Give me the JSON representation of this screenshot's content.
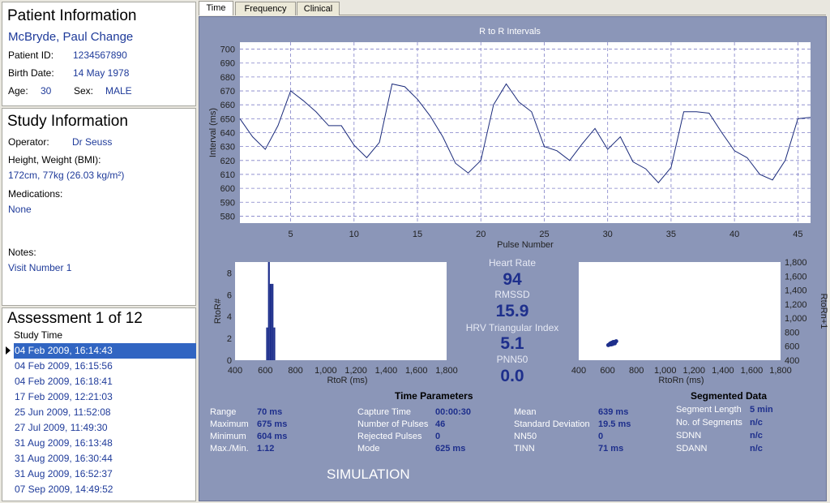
{
  "patient": {
    "title": "Patient Information",
    "name": "McBryde, Paul Change",
    "id_label": "Patient ID:",
    "id_value": "1234567890",
    "dob_label": "Birth Date:",
    "dob_value": "14 May 1978",
    "age_label": "Age:",
    "age_value": "30",
    "sex_label": "Sex:",
    "sex_value": "MALE"
  },
  "study": {
    "title": "Study Information",
    "operator_label": "Operator:",
    "operator_value": "Dr Seuss",
    "hw_label": "Height, Weight (BMI):",
    "hw_value": "172cm, 77kg (26.03 kg/m²)",
    "med_label": "Medications:",
    "med_value": "None",
    "notes_label": "Notes:",
    "notes_value": "Visit Number 1"
  },
  "assessment": {
    "title": "Assessment 1 of 12",
    "column": "Study Time",
    "selected_index": 0,
    "items": [
      "04 Feb 2009, 16:14:43",
      "04 Feb 2009, 16:15:56",
      "04 Feb 2009, 16:18:41",
      "17 Feb 2009, 12:21:03",
      "25 Jun 2009, 11:52:08",
      "27 Jul 2009, 11:49:30",
      "31 Aug 2009, 16:13:48",
      "31 Aug 2009, 16:30:44",
      "31 Aug 2009, 16:52:37",
      "07 Sep 2009, 14:49:52"
    ]
  },
  "tabs": [
    "Time",
    "Frequency",
    "Clinical"
  ],
  "active_tab": "Time",
  "chart_data": [
    {
      "type": "line",
      "title": "R to R Intervals",
      "xlabel": "Pulse Number",
      "ylabel": "Interval (ms)",
      "xlim": [
        1,
        46
      ],
      "ylim": [
        575,
        705
      ],
      "xticks": [
        5,
        10,
        15,
        20,
        25,
        30,
        35,
        40,
        45
      ],
      "yticks": [
        580,
        590,
        600,
        610,
        620,
        630,
        640,
        650,
        660,
        670,
        680,
        690,
        700
      ],
      "grid": true,
      "x": [
        1,
        2,
        3,
        4,
        5,
        6,
        7,
        8,
        9,
        10,
        11,
        12,
        13,
        14,
        15,
        16,
        17,
        18,
        19,
        20,
        21,
        22,
        23,
        24,
        25,
        26,
        27,
        28,
        29,
        30,
        31,
        32,
        33,
        34,
        35,
        36,
        37,
        38,
        39,
        40,
        41,
        42,
        43,
        44,
        45,
        46
      ],
      "values": [
        650,
        637,
        628,
        645,
        670,
        663,
        655,
        645,
        645,
        631,
        622,
        633,
        675,
        673,
        664,
        652,
        637,
        618,
        611,
        620,
        660,
        675,
        662,
        655,
        630,
        627,
        620,
        632,
        643,
        628,
        637,
        619,
        614,
        604,
        615,
        655,
        655,
        654,
        640,
        627,
        622,
        610,
        606,
        620,
        650,
        651
      ]
    },
    {
      "type": "bar",
      "title": "",
      "xlabel": "RtoR (ms)",
      "ylabel": "RtoR#",
      "xlim": [
        400,
        1800
      ],
      "ylim": [
        0,
        9
      ],
      "xticks": [
        400,
        600,
        800,
        1000,
        1200,
        1400,
        1600,
        1800
      ],
      "yticks": [
        0,
        2,
        4,
        6,
        8
      ],
      "bin_width": 12,
      "x": [
        612,
        624,
        636,
        648,
        660
      ],
      "values": [
        3,
        9,
        7,
        7,
        3
      ]
    },
    {
      "type": "scatter",
      "title": "",
      "xlabel": "RtoRn (ms)",
      "ylabel": "RtoRn+1",
      "xlim": [
        400,
        1800
      ],
      "ylim": [
        400,
        1800
      ],
      "xticks": [
        400,
        600,
        800,
        1000,
        1200,
        1400,
        1600,
        1800
      ],
      "yticks": [
        400,
        600,
        800,
        1000,
        1200,
        1400,
        1600,
        1800
      ],
      "points": [
        [
          605,
          615
        ],
        [
          615,
          630
        ],
        [
          620,
          640
        ],
        [
          630,
          650
        ],
        [
          640,
          660
        ],
        [
          650,
          640
        ],
        [
          660,
          670
        ],
        [
          625,
          625
        ],
        [
          645,
          645
        ],
        [
          610,
          620
        ],
        [
          655,
          665
        ],
        [
          635,
          630
        ]
      ]
    }
  ],
  "stats": {
    "hr_label": "Heart Rate",
    "hr_value": "94",
    "rmssd_label": "RMSSD",
    "rmssd_value": "15.9",
    "hrv_label": "HRV Triangular Index",
    "hrv_value": "5.1",
    "pnn_label": "PNN50",
    "pnn_value": "0.0"
  },
  "time_params": {
    "title": "Time Parameters",
    "col1": [
      [
        "Range",
        "70 ms"
      ],
      [
        "Maximum",
        "675 ms"
      ],
      [
        "Minimum",
        "604 ms"
      ],
      [
        "Max./Min.",
        "1.12"
      ]
    ],
    "col2": [
      [
        "Capture Time",
        "00:00:30"
      ],
      [
        "Number of Pulses",
        "46"
      ],
      [
        "Rejected Pulses",
        "0"
      ],
      [
        "Mode",
        "625 ms"
      ]
    ],
    "col3": [
      [
        "Mean",
        "639 ms"
      ],
      [
        "Standard Deviation",
        "19.5 ms"
      ],
      [
        "NN50",
        "0"
      ],
      [
        "TINN",
        "71 ms"
      ]
    ]
  },
  "segmented": {
    "title": "Segmented Data",
    "rows": [
      [
        "Segment Length",
        "5 min"
      ],
      [
        "No. of Segments",
        "n/c"
      ],
      [
        "SDNN",
        "n/c"
      ],
      [
        "SDANN",
        "n/c"
      ]
    ]
  },
  "footer": "SIMULATION"
}
